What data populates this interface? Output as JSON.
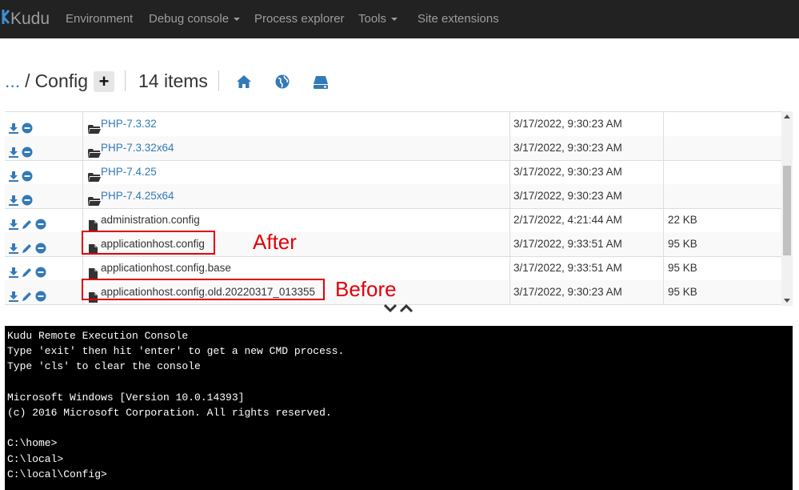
{
  "navbar": {
    "brand": "Kudu",
    "items": [
      {
        "label": "Environment"
      },
      {
        "label": "Debug console",
        "dropdown": true
      },
      {
        "label": "Process explorer"
      },
      {
        "label": "Tools",
        "dropdown": true
      },
      {
        "label": "Site extensions"
      }
    ]
  },
  "breadcrumb": {
    "ellipsis": "...",
    "separator": "/",
    "current": "Config",
    "add_label": "+",
    "item_count": "14 items"
  },
  "header_icons": [
    "home-icon",
    "globe-icon",
    "drive-icon"
  ],
  "files": [
    {
      "name": "PHP-7.3.32",
      "type": "folder",
      "modified": "3/17/2022, 9:30:23 AM",
      "size": ""
    },
    {
      "name": "PHP-7.3.32x64",
      "type": "folder",
      "modified": "3/17/2022, 9:30:23 AM",
      "size": ""
    },
    {
      "name": "PHP-7.4.25",
      "type": "folder",
      "modified": "3/17/2022, 9:30:23 AM",
      "size": ""
    },
    {
      "name": "PHP-7.4.25x64",
      "type": "folder",
      "modified": "3/17/2022, 9:30:23 AM",
      "size": ""
    },
    {
      "name": "administration.config",
      "type": "file",
      "modified": "2/17/2022, 4:21:44 AM",
      "size": "22 KB"
    },
    {
      "name": "applicationhost.config",
      "type": "file",
      "modified": "3/17/2022, 9:33:51 AM",
      "size": "95 KB"
    },
    {
      "name": "applicationhost.config.base",
      "type": "file",
      "modified": "3/17/2022, 9:33:51 AM",
      "size": "95 KB"
    },
    {
      "name": "applicationhost.config.old.20220317_013355",
      "type": "file",
      "modified": "3/17/2022, 9:30:23 AM",
      "size": "95 KB"
    }
  ],
  "annotations": {
    "after": "After",
    "before": "Before",
    "color": "#e3000b"
  },
  "console": {
    "lines": [
      "Kudu Remote Execution Console",
      "Type 'exit' then hit 'enter' to get a new CMD process.",
      "Type 'cls' to clear the console",
      "",
      "Microsoft Windows [Version 10.0.14393]",
      "(c) 2016 Microsoft Corporation. All rights reserved.",
      "",
      "C:\\home>",
      "C:\\local>",
      "C:\\local\\Config>"
    ]
  },
  "colors": {
    "navbar_bg": "#222222",
    "nav_text": "#9d9d9d",
    "link": "#337ab7",
    "console_bg": "#000000"
  }
}
